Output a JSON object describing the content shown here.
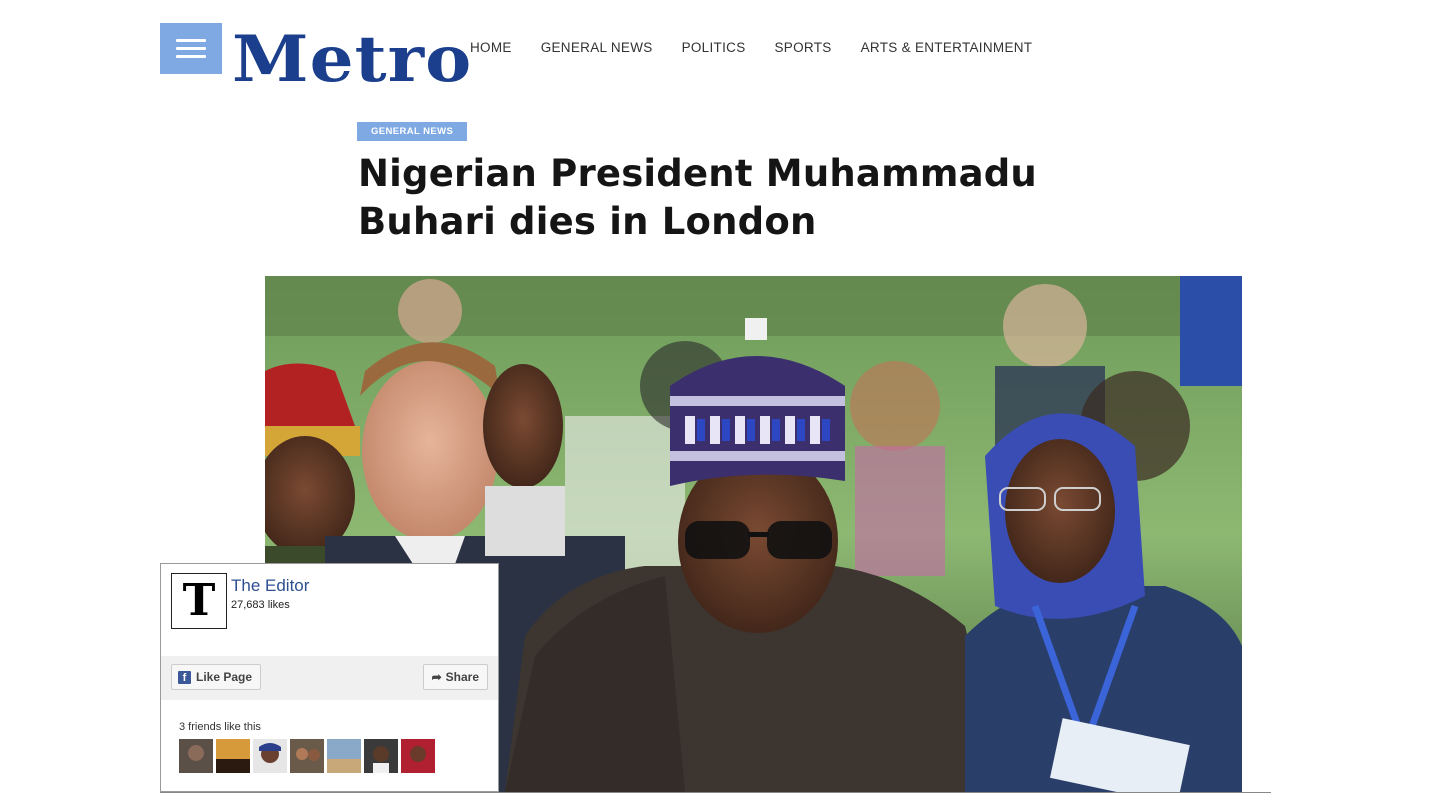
{
  "header": {
    "logo": "Metro",
    "nav": [
      "HOME",
      "GENERAL NEWS",
      "POLITICS",
      "SPORTS",
      "ARTS & ENTERTAINMENT"
    ]
  },
  "article": {
    "category": "GENERAL NEWS",
    "headline": "Nigerian President Muhammadu Buhari dies in London"
  },
  "facebook_widget": {
    "page_name": "The Editor",
    "likes": "27,683 likes",
    "logo_letter": "T",
    "like_button": "Like Page",
    "share_button": "Share",
    "friends_text": "3 friends like this"
  },
  "colors": {
    "accent": "#7fa9e3",
    "logo": "#1b3f8c",
    "facebook": "#3b5998"
  }
}
